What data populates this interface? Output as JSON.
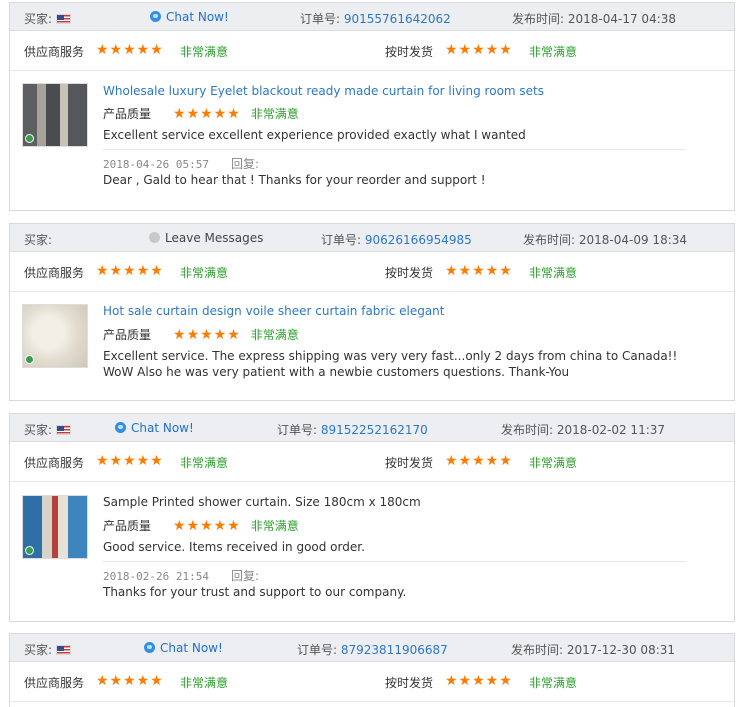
{
  "labels": {
    "buyer": "买家:",
    "order": "订单号:",
    "published": "发布时间:",
    "supplier_service": "供应商服务",
    "on_time": "按时发货",
    "quality": "产品质量",
    "very_satisfied": "非常满意",
    "reply": "回复:",
    "stars": "★★★★★"
  },
  "reviews": [
    {
      "contact": "Chat Now!",
      "order_no": "90155761642062",
      "publish_time": "2018-04-17 04:38",
      "product": "Wholesale luxury Eyelet blackout ready made curtain for living room sets",
      "comment": "Excellent service excellent experience provided exactly what I wanted",
      "reply_date": "2018-04-26 05:57",
      "reply": "Dear , Gald to hear that ! Thanks for your reorder and support !"
    },
    {
      "contact": "Leave Messages",
      "order_no": "90626166954985",
      "publish_time": "2018-04-09 18:34",
      "product": "Hot sale curtain design voile sheer curtain fabric elegant",
      "comment": "Excellent service. The express shipping was very very fast...only 2 days from china to Canada!! WoW Also he was very patient with a newbie customers questions. Thank-You"
    },
    {
      "contact": "Chat Now!",
      "order_no": "89152252162170",
      "publish_time": "2018-02-02 11:37",
      "product": "Sample Printed shower curtain. Size 180cm x 180cm",
      "comment": "Good service. Items received in good order.",
      "reply_date": "2018-02-26 21:54",
      "reply": "Thanks for your trust and support to our company."
    },
    {
      "contact": "Chat Now!",
      "order_no": "87923811906687",
      "publish_time": "2017-12-30 08:31"
    }
  ]
}
